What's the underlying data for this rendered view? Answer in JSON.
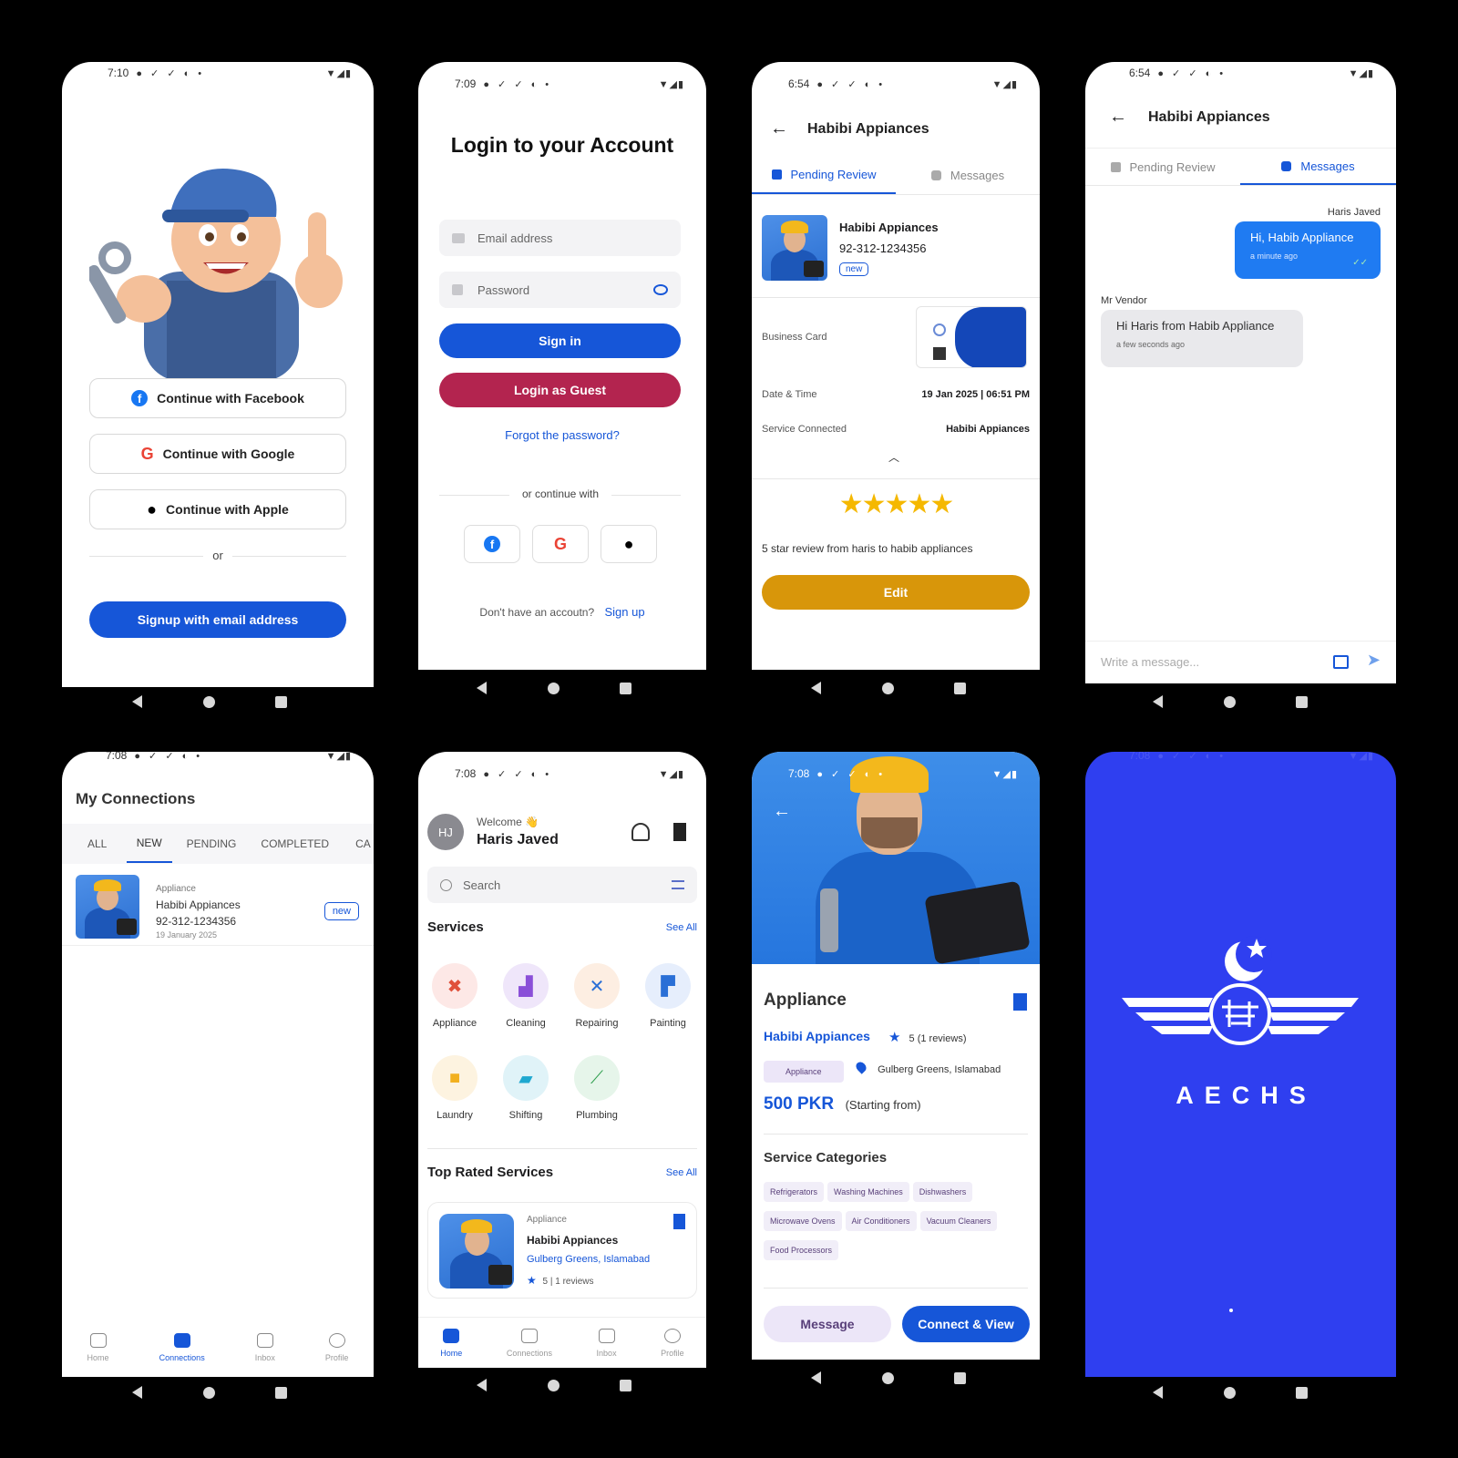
{
  "screen1": {
    "status_time": "7:10",
    "facebook_btn": "Continue with Facebook",
    "google_btn": "Continue with Google",
    "apple_btn": "Continue with Apple",
    "or_label": "or",
    "signup_btn": "Signup with email address"
  },
  "screen2": {
    "status_time": "7:09",
    "title": "Login to your Account",
    "email_placeholder": "Email address",
    "password_placeholder": "Password",
    "signin_btn": "Sign in",
    "guest_btn": "Login as Guest",
    "forgot": "Forgot the password?",
    "or_continue": "or continue with",
    "no_account": "Don't have an accoutn?",
    "signup": "Sign up"
  },
  "screen3": {
    "status_time": "6:54",
    "header_title": "Habibi Appiances",
    "tab_pending": "Pending Review",
    "tab_messages": "Messages",
    "vendor_name": "Habibi Appiances",
    "vendor_phone": "92-312-1234356",
    "badge": "new",
    "business_card_label": "Business Card",
    "datetime_label": "Date & Time",
    "datetime_value": "19 Jan 2025 | 06:51 PM",
    "service_label": "Service Connected",
    "service_value": "Habibi Appiances",
    "rating": 5,
    "review_text": "5 star review from haris to habib appliances",
    "edit_btn": "Edit"
  },
  "screen4": {
    "status_time": "6:54",
    "header_title": "Habibi Appiances",
    "tab_pending": "Pending Review",
    "tab_messages": "Messages",
    "sender_name": "Haris Javed",
    "sent_text": "Hi, Habib Appliance",
    "sent_time": "a minute ago",
    "receiver_name": "Mr Vendor",
    "received_text": "Hi Haris from Habib Appliance",
    "received_time": "a few seconds ago",
    "input_placeholder": "Write a message..."
  },
  "screen5": {
    "status_time": "7:08",
    "title": "My Connections",
    "tabs": [
      "ALL",
      "NEW",
      "PENDING",
      "COMPLETED",
      "CA"
    ],
    "item_category": "Appliance",
    "item_name": "Habibi Appiances",
    "item_phone": "92-312-1234356",
    "item_date": "19 January 2025",
    "badge": "new",
    "nav": [
      "Home",
      "Connections",
      "Inbox",
      "Profile"
    ]
  },
  "screen6": {
    "status_time": "7:08",
    "avatar_initials": "HJ",
    "welcome": "Welcome 👋",
    "user_name": "Haris Javed",
    "search_placeholder": "Search",
    "services_title": "Services",
    "see_all": "See All",
    "services": [
      "Appliance",
      "Cleaning",
      "Repairing",
      "Painting",
      "Laundry",
      "Shifting",
      "Plumbing"
    ],
    "top_rated_title": "Top Rated Services",
    "card_category": "Appliance",
    "card_name": "Habibi Appiances",
    "card_location": "Gulberg Greens, Islamabad",
    "card_rating": "5 | 1 reviews",
    "nav": [
      "Home",
      "Connections",
      "Inbox",
      "Profile"
    ]
  },
  "screen7": {
    "status_time": "7:08",
    "title": "Appliance",
    "vendor": "Habibi Appiances",
    "rating": "5 (1 reviews)",
    "category_chip": "Appliance",
    "location": "Gulberg Greens, Islamabad",
    "price": "500 PKR",
    "price_note": "(Starting from)",
    "categories_title": "Service Categories",
    "categories": [
      "Refrigerators",
      "Washing Machines",
      "Dishwashers",
      "Microwave Ovens",
      "Air Conditioners",
      "Vacuum Cleaners",
      "Food Processors"
    ],
    "message_btn": "Message",
    "connect_btn": "Connect & View"
  },
  "screen8": {
    "status_time": "7:08",
    "brand": "AECHS"
  },
  "colors": {
    "primary": "#1656d8",
    "guest": "#b3244f",
    "edit": "#d8960a",
    "splash": "#2f3ff0"
  }
}
